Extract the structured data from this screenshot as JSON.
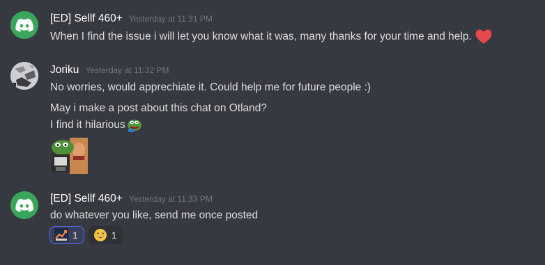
{
  "messages": [
    {
      "author": "[ED] Sellf 460+",
      "timestamp": "Yesterday at 11:31 PM",
      "avatar_icon": "discord-logo-icon",
      "lines": [
        "When I find the issue i will let you know what it was, many thanks for your time and help."
      ],
      "trailing_emoji": "red-heart-emoji"
    },
    {
      "author": "Joriku",
      "timestamp": "Yesterday at 11:32 PM",
      "avatar_icon": "user-avatar",
      "lines": [
        "No worries, would apprechiate it. Could help me for future people :)",
        "May i make a post about this chat on Otland?",
        "I find it hilarious"
      ],
      "inline_emoji": "pepe-laugh-emoji",
      "sticker": "pepe-reaction-sticker"
    },
    {
      "author": "[ED] Sellf 460+",
      "timestamp": "Yesterday at 11:33 PM",
      "avatar_icon": "discord-logo-icon",
      "lines": [
        "do whatever you like, send me once posted"
      ],
      "reactions": [
        {
          "emoji": "custom-stonks-emoji",
          "count": "1",
          "active": true
        },
        {
          "emoji": "grinning-sweat-emoji",
          "count": "1",
          "active": false
        }
      ]
    }
  ],
  "colors": {
    "background": "#36393f",
    "discord_green": "#3ba55c",
    "heart_red": "#e5484d",
    "reaction_active_border": "#5865f2"
  }
}
